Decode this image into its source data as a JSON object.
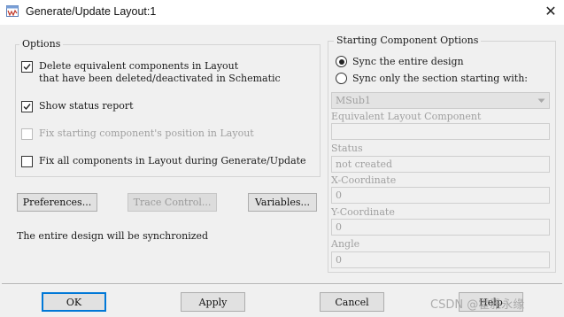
{
  "window": {
    "title": "Generate/Update Layout:1",
    "close_glyph": "✕",
    "icon": "ads-app-icon"
  },
  "options": {
    "title": "Options",
    "delete_equivalent": {
      "line1": "Delete equivalent components in Layout",
      "line2": "that have been deleted/deactivated in Schematic",
      "checked": true
    },
    "show_status": {
      "label": "Show status report",
      "checked": true
    },
    "fix_starting": {
      "label": "Fix starting component's position in Layout",
      "checked": false,
      "disabled": true
    },
    "fix_all": {
      "label": "Fix all components in Layout during Generate/Update",
      "checked": false
    }
  },
  "buttons": {
    "preferences": "Preferences...",
    "trace_control": "Trace Control...",
    "variables": "Variables...",
    "ok": "OK",
    "apply": "Apply",
    "cancel": "Cancel",
    "help": "Help"
  },
  "status_message": "The entire design will be synchronized",
  "starting": {
    "title": "Starting Component Options",
    "sync_entire": "Sync the entire design",
    "sync_section": "Sync only the section starting with:",
    "selected": "sync_entire",
    "component": "MSub1",
    "equivalent_label": "Equivalent Layout Component",
    "equivalent_value": "",
    "status_label": "Status",
    "status_value": "not created",
    "x_label": "X-Coordinate",
    "x_value": "0",
    "y_label": "Y-Coordinate",
    "y_value": "0",
    "angle_label": "Angle",
    "angle_value": "0"
  },
  "watermark": "CSDN @霍雅永缘"
}
